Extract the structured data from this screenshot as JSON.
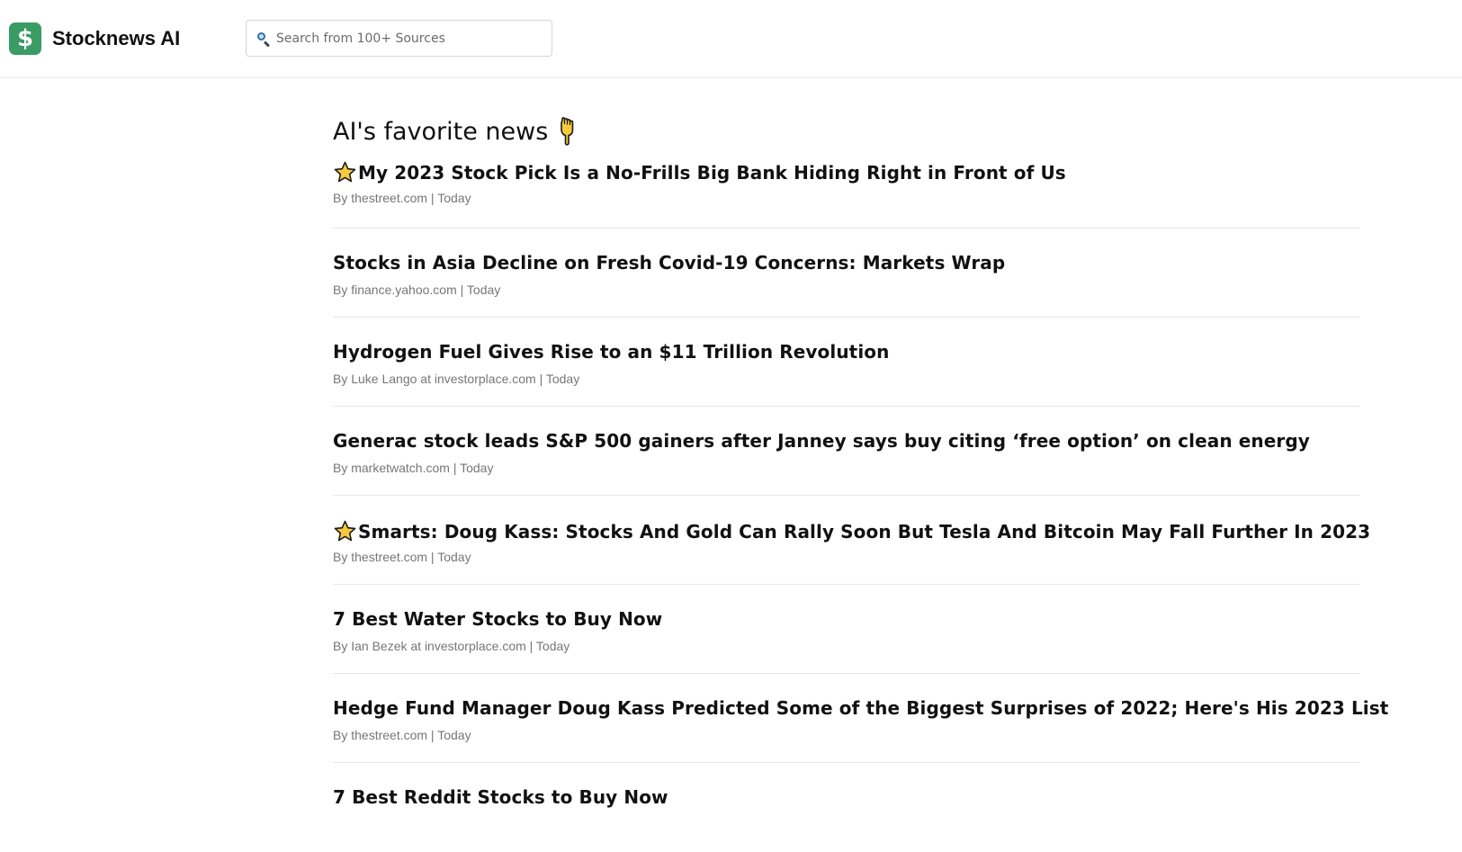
{
  "header": {
    "brand": "Stocknews AI",
    "logo_symbol": "$",
    "logo_color": "#3a9b64",
    "search": {
      "placeholder": "Search from 100+ Sources",
      "value": ""
    }
  },
  "main": {
    "section_title": "AI's favorite news",
    "section_icon": "pointing-down-icon",
    "articles": [
      {
        "starred": true,
        "title": "My 2023 Stock Pick Is a No-Frills Big Bank Hiding Right in Front of Us",
        "meta": "By thestreet.com | Today"
      },
      {
        "starred": false,
        "title": "Stocks in Asia Decline on Fresh Covid-19 Concerns: Markets Wrap",
        "meta": "By finance.yahoo.com | Today"
      },
      {
        "starred": false,
        "title": "Hydrogen Fuel Gives Rise to an $11 Trillion Revolution",
        "meta": "By Luke Lango at investorplace.com | Today"
      },
      {
        "starred": false,
        "title": "Generac stock leads S&P 500 gainers after Janney says buy citing ‘free option’ on clean energy",
        "meta": "By marketwatch.com | Today"
      },
      {
        "starred": true,
        "title": "Smarts: Doug Kass: Stocks And Gold Can Rally Soon But Tesla And Bitcoin May Fall Further In 2023",
        "meta": "By thestreet.com | Today"
      },
      {
        "starred": false,
        "title": "7 Best Water Stocks to Buy Now",
        "meta": "By Ian Bezek at investorplace.com | Today"
      },
      {
        "starred": false,
        "title": "Hedge Fund Manager Doug Kass Predicted Some of the Biggest Surprises of 2022; Here's His 2023 List",
        "meta": "By thestreet.com | Today"
      },
      {
        "starred": false,
        "title": "7 Best Reddit Stocks to Buy Now",
        "meta": ""
      }
    ]
  },
  "colors": {
    "divider": "#e5e7eb",
    "meta_text": "#777777",
    "star_fill": "#f7c93c",
    "star_stroke": "#1a1a1a"
  }
}
